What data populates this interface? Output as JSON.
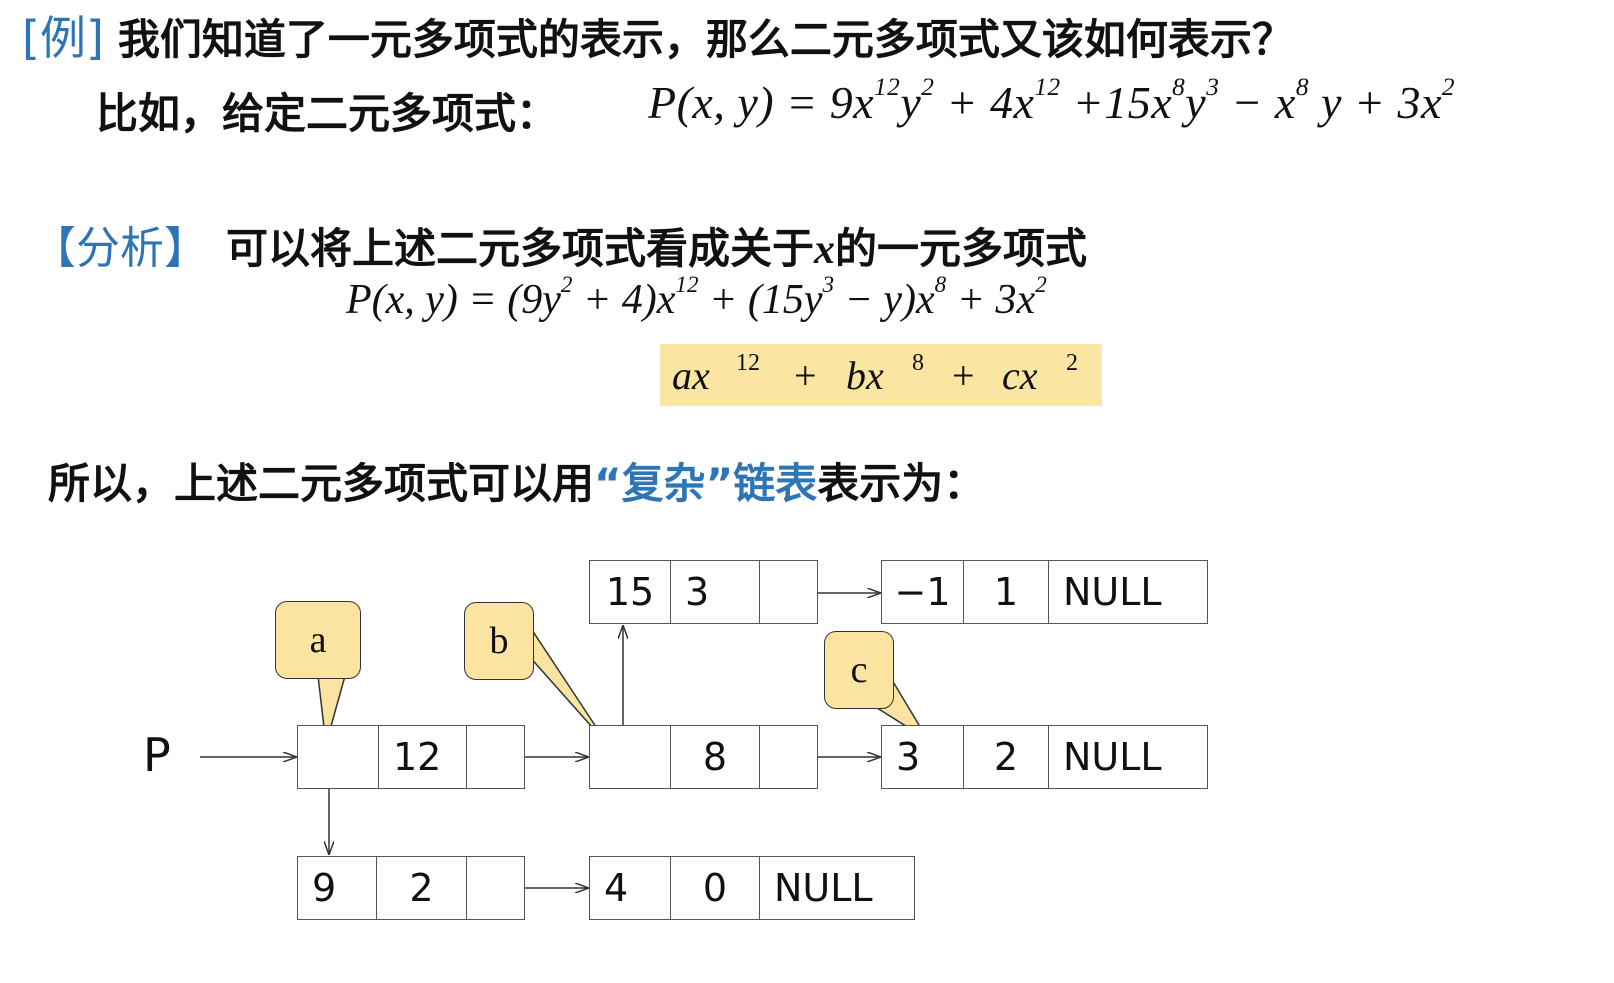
{
  "line1": {
    "tag": "[例]",
    "text": "我们知道了一元多项式的表示，那么二元多项式又该如何表示？"
  },
  "line2": {
    "text": "比如，给定二元多项式："
  },
  "eq1": {
    "lhs": "P(x, y) = 9x",
    "e1": "12",
    "y1": "y",
    "e2": "2",
    "t2": " + 4x",
    "e3": "12",
    "t3": " +15x",
    "e4": "8",
    "y2": "y",
    "e5": "3",
    "t4": " − x",
    "e6": "8",
    "t5": "y + 3x",
    "e7": "2"
  },
  "line3": {
    "tag": "【分析】",
    "text1": "可以将上述二元多项式看成关于",
    "var": "x",
    "text2": "的一元多项式"
  },
  "eq2": {
    "a": "P(x, y) = (9y",
    "e1": "2",
    "b": " + 4)x",
    "e2": "12",
    "c": " + (15y",
    "e3": "3",
    "d": " − y)x",
    "e4": "8",
    "f": " + 3x",
    "e5": "2"
  },
  "highlight": {
    "ax": "ax",
    "exp12": "12",
    "plus1": "+",
    "bx": "bx",
    "exp8": "8",
    "plus2": "+",
    "cx": "cx",
    "exp2": "2"
  },
  "line4": {
    "text1": "所以，上述二元多项式可以用",
    "quoted": "“复杂”链表",
    "text2": "表示为："
  },
  "diagram": {
    "pointer": "P",
    "row_top": {
      "c1": "15",
      "c2": "3",
      "n1": "−1",
      "n2": "1",
      "null": "NULL"
    },
    "row_mid": {
      "exp_a": "12",
      "exp_b": "8",
      "n1": "3",
      "n2": "2",
      "null": "NULL"
    },
    "row_bot": {
      "c1": "9",
      "c2": "2",
      "n1": "4",
      "n2": "0",
      "null": "NULL"
    },
    "bubbles": {
      "a": "a",
      "b": "b",
      "c": "c"
    }
  }
}
